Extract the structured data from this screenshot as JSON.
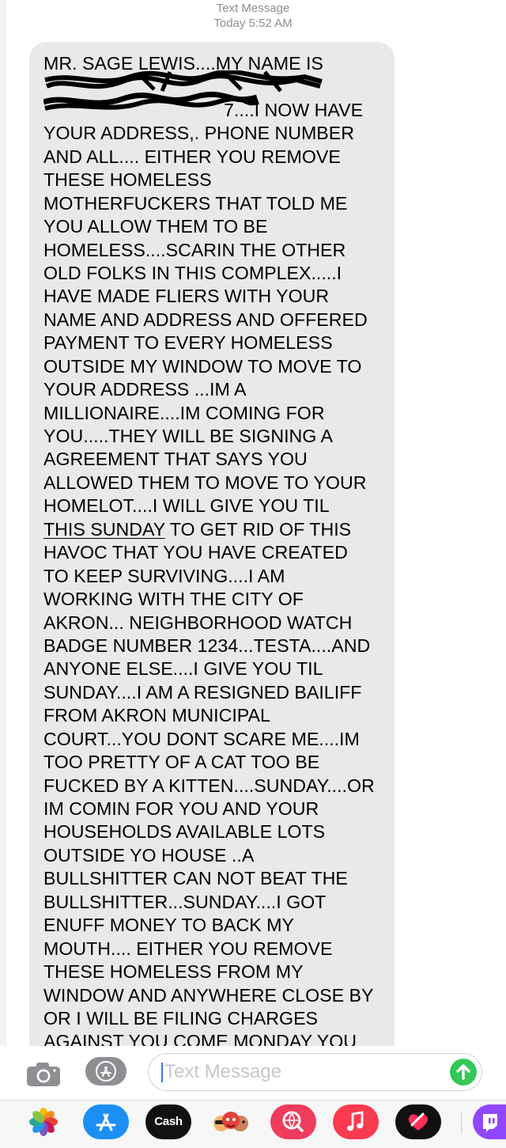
{
  "header": {
    "title": "Text Message",
    "timestamp": "Today 5:52 AM"
  },
  "message": {
    "lines": [
      "MR. SAGE LEWIS....MY NAME IS",
      "",
      "7....I NOW HAVE",
      "YOUR ADDRESS,. PHONE NUMBER",
      "AND ALL.... EITHER YOU REMOVE",
      "THESE HOMELESS",
      "MOTHERFUCKERS THAT TOLD ME",
      "YOU ALLOW THEM TO BE",
      "HOMELESS....SCARIN THE OTHER",
      "OLD FOLKS IN THIS COMPLEX.....I",
      "HAVE MADE FLIERS WITH YOUR",
      "NAME AND ADDRESS AND OFFERED",
      "PAYMENT TO  EVERY HOMELESS",
      "OUTSIDE MY WINDOW TO MOVE TO",
      "YOUR ADDRESS ...IM A",
      "MILLIONAIRE....IM COMING FOR",
      "YOU.....THEY WILL BE SIGNING A",
      "AGREEMENT THAT SAYS YOU",
      "ALLOWED THEM TO MOVE TO YOUR",
      "HOMELOT....I WILL GIVE YOU TIL",
      "THIS SUNDAY",
      "HAVOC THAT YOU HAVE CREATED",
      "TO KEEP SURVIVING....I AM",
      "WORKING WITH THE CITY OF",
      "AKRON... NEIGHBORHOOD WATCH",
      "BADGE NUMBER 1234...TESTA....AND",
      "ANYONE ELSE....I GIVE YOU TIL",
      "SUNDAY....I AM A RESIGNED BAILIFF",
      "FROM AKRON MUNICIPAL",
      "COURT...YOU DONT SCARE ME....IM",
      "TOO PRETTY OF A CAT TOO BE",
      "FUCKED BY A KITTEN....SUNDAY....OR",
      "IM COMIN FOR YOU AND YOUR",
      "HOUSEHOLDS AVAILABLE LOTS",
      "OUTSIDE YO HOUSE ..A",
      "BULLSHITTER CAN NOT BEAT THE",
      "BULLSHITTER...SUNDAY....I GOT",
      "ENUFF MONEY TO BACK MY",
      "MOUTH.... EITHER YOU REMOVE",
      "THESE HOMELESS FROM MY",
      "WINDOW AND ANYWHERE CLOSE BY",
      "OR I WILL BE FILING CHARGES",
      "AGAINST YOU COME MONDAY  YOU"
    ],
    "line21_suffix": " TO GET RID OF THIS"
  },
  "composer": {
    "placeholder": "Text Message",
    "camera_icon": "camera-icon",
    "apps_icon": "app-store-icon",
    "send_icon": "send-arrow-icon",
    "send_color": "#34c759"
  },
  "dock": {
    "apps": [
      {
        "name": "photos-icon"
      },
      {
        "name": "app-store-icon"
      },
      {
        "name": "cash-app-icon",
        "label": "Cash"
      },
      {
        "name": "memoji-icon"
      },
      {
        "name": "search-images-icon"
      },
      {
        "name": "music-icon"
      },
      {
        "name": "digital-touch-icon"
      },
      {
        "name": "twitch-icon"
      }
    ]
  },
  "colors": {
    "bubble": "#e9e9eb",
    "meta_text": "#8e8e93",
    "accent": "#3478f6"
  }
}
